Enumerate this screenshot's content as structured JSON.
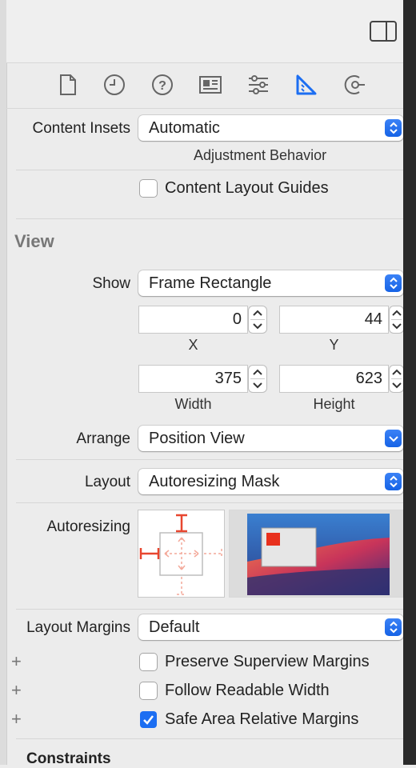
{
  "tabs": [
    {
      "name": "file-inspector-tab",
      "icon": "document-icon"
    },
    {
      "name": "history-inspector-tab",
      "icon": "clock-icon"
    },
    {
      "name": "quick-help-tab",
      "icon": "question-icon"
    },
    {
      "name": "identity-inspector-tab",
      "icon": "id-card-icon"
    },
    {
      "name": "attributes-inspector-tab",
      "icon": "sliders-icon"
    },
    {
      "name": "size-inspector-tab",
      "icon": "ruler-icon",
      "selected": true
    },
    {
      "name": "connections-inspector-tab",
      "icon": "arrow-circle-icon"
    }
  ],
  "scroll": {
    "content_insets_label": "Content Insets",
    "content_insets_value": "Automatic",
    "adjustment_behavior": "Adjustment Behavior",
    "content_layout_guides": "Content Layout Guides"
  },
  "view": {
    "section_title": "View",
    "show_label": "Show",
    "show_value": "Frame Rectangle",
    "x_value": "0",
    "y_value": "44",
    "x_caption": "X",
    "y_caption": "Y",
    "width_value": "375",
    "height_value": "623",
    "width_caption": "Width",
    "height_caption": "Height",
    "arrange_label": "Arrange",
    "arrange_value": "Position View",
    "layout_label": "Layout",
    "layout_value": "Autoresizing Mask",
    "autoresizing_label": "Autoresizing"
  },
  "margins": {
    "layout_margins_label": "Layout Margins",
    "layout_margins_value": "Default",
    "preserve_superview": "Preserve Superview Margins",
    "follow_readable": "Follow Readable Width",
    "safe_area_relative": "Safe Area Relative Margins",
    "safe_area_checked": true
  },
  "constraints": {
    "title": "Constraints"
  },
  "colors": {
    "accent": "#1c6ef2",
    "autoresize": "#e8462f"
  }
}
